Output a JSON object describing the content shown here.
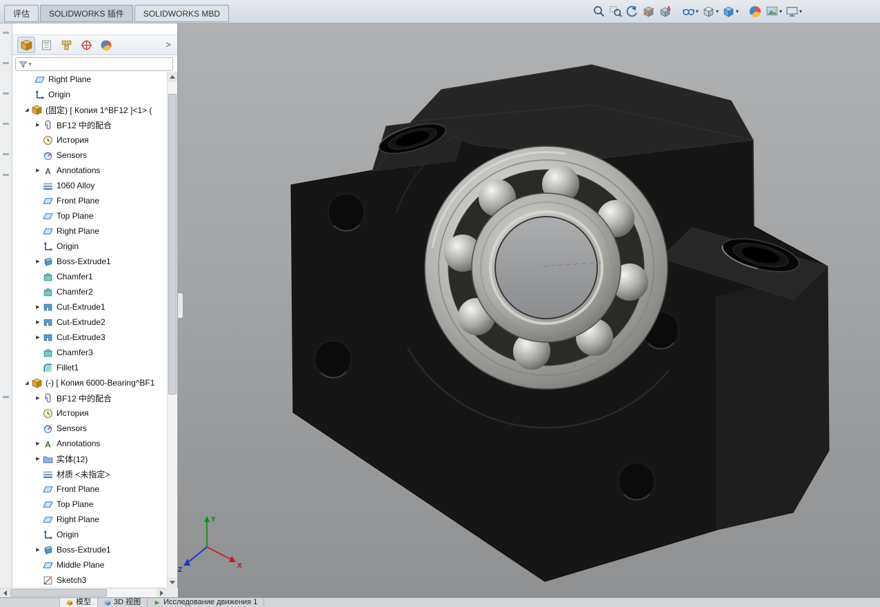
{
  "ribbon": {
    "tabs": [
      {
        "label": "评估",
        "active": false
      },
      {
        "label": "SOLIDWORKS 插件",
        "active": true
      },
      {
        "label": "SOLIDWORKS MBD",
        "active": false
      }
    ]
  },
  "heads_up_toolbar": {
    "items": [
      {
        "name": "zoom-to-fit-icon",
        "icon": "zoom-to-fit",
        "caret": false,
        "gap": false
      },
      {
        "name": "zoom-to-area-icon",
        "icon": "zoom-to-area",
        "caret": false,
        "gap": false
      },
      {
        "name": "previous-view-icon",
        "icon": "previous-view",
        "caret": false,
        "gap": false
      },
      {
        "name": "section-view-icon",
        "icon": "section-view",
        "caret": false,
        "gap": false
      },
      {
        "name": "annotation-views-icon",
        "icon": "annotation-views",
        "caret": false,
        "gap": false
      },
      {
        "name": "hide-show-items-icon",
        "icon": "hide-show-items",
        "caret": true,
        "gap": true
      },
      {
        "name": "display-style-icon",
        "icon": "display-style",
        "caret": true,
        "gap": false
      },
      {
        "name": "view-orientation-icon",
        "icon": "view-orientation",
        "caret": true,
        "gap": false
      },
      {
        "name": "edit-appearance-icon",
        "icon": "edit-appearance",
        "caret": false,
        "gap": true
      },
      {
        "name": "apply-scene-icon",
        "icon": "apply-scene",
        "caret": true,
        "gap": false
      },
      {
        "name": "view-settings-icon",
        "icon": "view-settings",
        "caret": true,
        "gap": false
      }
    ]
  },
  "feature_tree": {
    "header_buttons": [
      "featuremanager-tree",
      "propertymanager",
      "configurationmanager",
      "dimxpertmanager",
      "displaymanager"
    ],
    "chevron": ">",
    "filter_icon": "filter-funnel-icon",
    "items": [
      {
        "label": "Right Plane",
        "icon": "plane",
        "ind": 18,
        "exp": "n"
      },
      {
        "label": "Origin",
        "icon": "origin",
        "ind": 18,
        "exp": "n"
      },
      {
        "label": "(固定) [ Копия 1^BF12 ]<1> (",
        "icon": "component",
        "ind": 14,
        "exp": "e"
      },
      {
        "label": "BF12 中的配合",
        "icon": "mates",
        "ind": 30,
        "exp": "c"
      },
      {
        "label": "История",
        "icon": "history",
        "ind": 30,
        "exp": "n"
      },
      {
        "label": "Sensors",
        "icon": "sensors",
        "ind": 30,
        "exp": "n"
      },
      {
        "label": "Annotations",
        "icon": "annotations",
        "ind": 30,
        "exp": "c"
      },
      {
        "label": "1060 Alloy",
        "icon": "material",
        "ind": 30,
        "exp": "n"
      },
      {
        "label": "Front Plane",
        "icon": "plane",
        "ind": 30,
        "exp": "n"
      },
      {
        "label": "Top Plane",
        "icon": "plane",
        "ind": 30,
        "exp": "n"
      },
      {
        "label": "Right Plane",
        "icon": "plane",
        "ind": 30,
        "exp": "n"
      },
      {
        "label": "Origin",
        "icon": "origin",
        "ind": 30,
        "exp": "n"
      },
      {
        "label": "Boss-Extrude1",
        "icon": "boss-extrude",
        "ind": 30,
        "exp": "c"
      },
      {
        "label": "Chamfer1",
        "icon": "chamfer",
        "ind": 30,
        "exp": "n"
      },
      {
        "label": "Chamfer2",
        "icon": "chamfer",
        "ind": 30,
        "exp": "n"
      },
      {
        "label": "Cut-Extrude1",
        "icon": "cut-extrude",
        "ind": 30,
        "exp": "c"
      },
      {
        "label": "Cut-Extrude2",
        "icon": "cut-extrude",
        "ind": 30,
        "exp": "c"
      },
      {
        "label": "Cut-Extrude3",
        "icon": "cut-extrude",
        "ind": 30,
        "exp": "c"
      },
      {
        "label": "Chamfer3",
        "icon": "chamfer",
        "ind": 30,
        "exp": "n"
      },
      {
        "label": "Fillet1",
        "icon": "fillet",
        "ind": 30,
        "exp": "n"
      },
      {
        "label": "(-) [ Копия 6000-Bearing^BF1",
        "icon": "component",
        "ind": 14,
        "exp": "e"
      },
      {
        "label": "BF12 中的配合",
        "icon": "mates",
        "ind": 30,
        "exp": "c"
      },
      {
        "label": "История",
        "icon": "history",
        "ind": 30,
        "exp": "n"
      },
      {
        "label": "Sensors",
        "icon": "sensors",
        "ind": 30,
        "exp": "n"
      },
      {
        "label": "Annotations",
        "icon": "annotations",
        "ind": 30,
        "exp": "c"
      },
      {
        "label": "实体(12)",
        "icon": "solids-folder",
        "ind": 30,
        "exp": "c"
      },
      {
        "label": "材质 <未指定>",
        "icon": "material",
        "ind": 30,
        "exp": "n"
      },
      {
        "label": "Front Plane",
        "icon": "plane",
        "ind": 30,
        "exp": "n"
      },
      {
        "label": "Top Plane",
        "icon": "plane",
        "ind": 30,
        "exp": "n"
      },
      {
        "label": "Right Plane",
        "icon": "plane",
        "ind": 30,
        "exp": "n"
      },
      {
        "label": "Origin",
        "icon": "origin",
        "ind": 30,
        "exp": "n"
      },
      {
        "label": "Boss-Extrude1",
        "icon": "boss-extrude",
        "ind": 30,
        "exp": "c"
      },
      {
        "label": "Middle Plane",
        "icon": "plane",
        "ind": 30,
        "exp": "n"
      },
      {
        "label": "Sketch3",
        "icon": "sketch",
        "ind": 30,
        "exp": "n"
      }
    ]
  },
  "viewport": {
    "triad": {
      "x": "X",
      "y": "Y",
      "z": "Z"
    }
  },
  "status_bar": {
    "tabs": [
      {
        "label": "模型",
        "active": true
      },
      {
        "label": "3D 视图",
        "active": false
      },
      {
        "label": "Исследование движения 1",
        "active": false
      }
    ]
  },
  "colors": {
    "viewport_top": "#aeb0b2",
    "viewport_bottom": "#8e9092",
    "part_black": "#161616",
    "bearing_silver": "#c9c9c5",
    "topbar_bg": "#d9e0e7",
    "panel_bg": "#ffffff"
  }
}
